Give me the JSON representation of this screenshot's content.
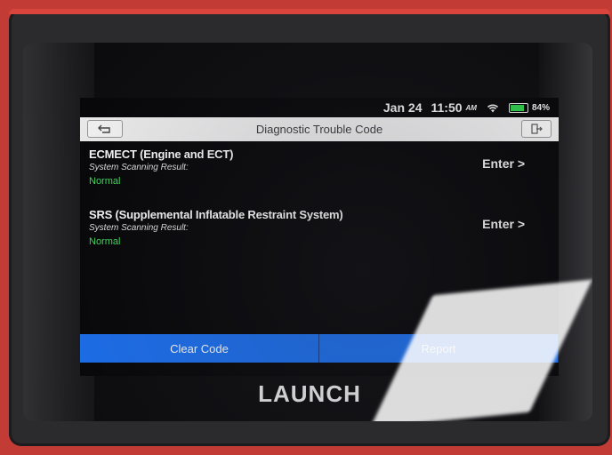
{
  "status_bar": {
    "date": "Jan 24",
    "time": "11:50",
    "ampm": "AM",
    "battery": "84%",
    "battery_level": 0.84
  },
  "titlebar": {
    "title": "Diagnostic Trouble Code"
  },
  "systems": [
    {
      "name": "ECMECT (Engine and ECT)",
      "subtitle": "System Scanning Result:",
      "status": "Normal",
      "action": "Enter >"
    },
    {
      "name": "SRS (Supplemental Inflatable Restraint System)",
      "subtitle": "System Scanning Result:",
      "status": "Normal",
      "action": "Enter >"
    }
  ],
  "actions": {
    "clear_code": "Clear Code",
    "report": "Report"
  },
  "brand": {
    "name": "LAUNCH"
  },
  "colors": {
    "accent_blue": "#1a6ff0",
    "status_green": "#3ee05b",
    "device_frame": "#2b2b2d",
    "outer_case": "#c23b35"
  }
}
